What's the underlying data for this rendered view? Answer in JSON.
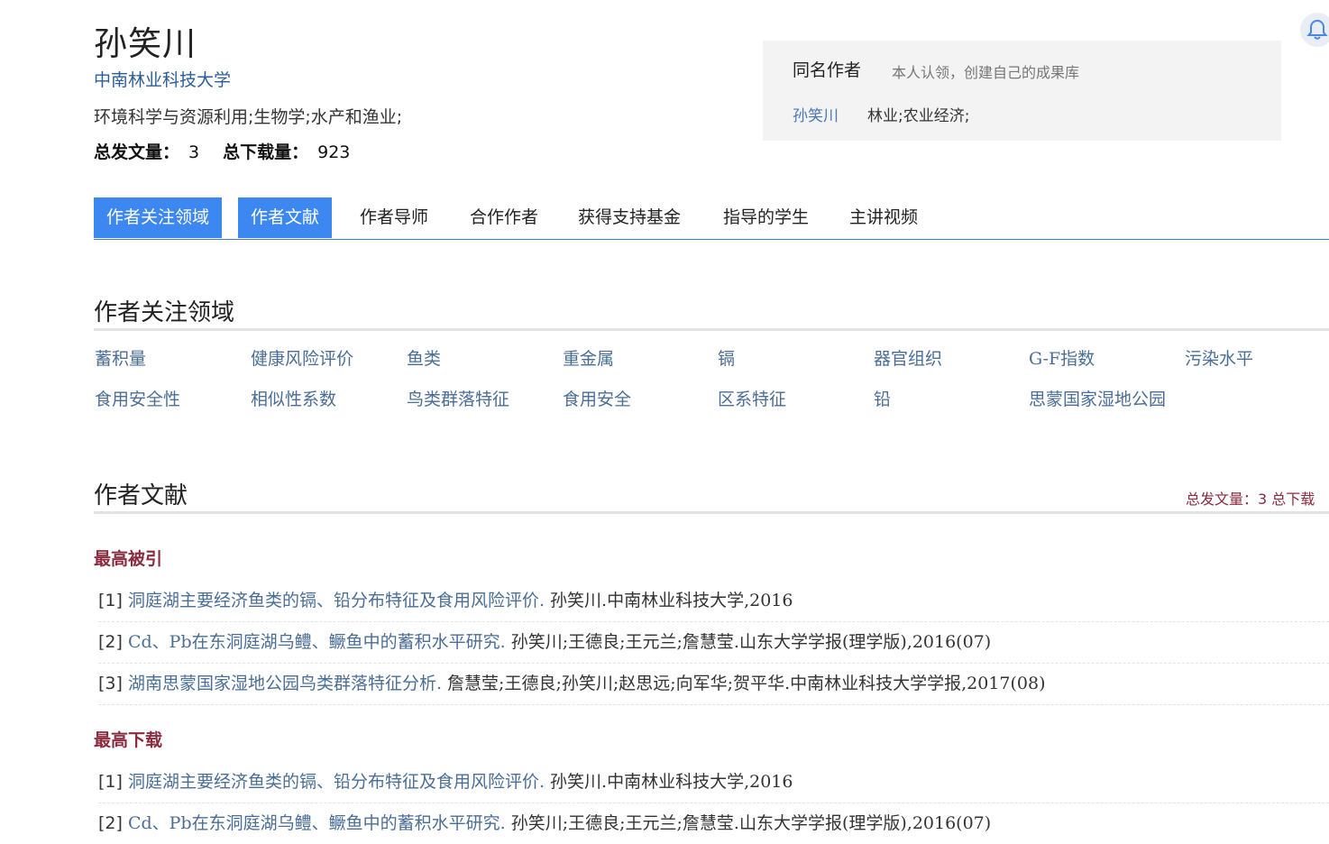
{
  "author": {
    "name": "孙笑川",
    "affiliation": "中南林业科技大学",
    "fields": "环境科学与资源利用;生物学;水产和渔业;",
    "total_pubs_label": "总发文量：",
    "total_pubs": "3",
    "total_downloads_label": "总下载量：",
    "total_downloads": "923"
  },
  "same_name": {
    "title": "同名作者",
    "hint": "本人认领，创建自己的成果库",
    "author_link": "孙笑川",
    "author_field": "林业;农业经济;"
  },
  "tabs": [
    "作者关注领域",
    "作者文献",
    "作者导师",
    "合作作者",
    "获得支持基金",
    "指导的学生",
    "主讲视频"
  ],
  "focus": {
    "title": "作者关注领域",
    "keywords_row1": [
      "蓄积量",
      "健康风险评价",
      "鱼类",
      "重金属",
      "镉",
      "器官组织",
      "G-F指数",
      "污染水平"
    ],
    "keywords_row2": [
      "食用安全性",
      "相似性系数",
      "鸟类群落特征",
      "食用安全",
      "区系特征",
      "铅",
      "思蒙国家湿地公园"
    ]
  },
  "literature": {
    "title": "作者文献",
    "summary": "总发文量：3 总下载",
    "most_cited": {
      "label": "最高被引",
      "items": [
        {
          "idx": "[1]",
          "title": "洞庭湖主要经济鱼类的镉、铅分布特征及食用风险评价.",
          "meta": " 孙笑川.中南林业科技大学,2016"
        },
        {
          "idx": "[2]",
          "title": "Cd、Pb在东洞庭湖乌鳢、鳜鱼中的蓄积水平研究.",
          "meta": " 孙笑川;王德良;王元兰;詹慧莹.山东大学学报(理学版),2016(07)"
        },
        {
          "idx": "[3]",
          "title": "湖南思蒙国家湿地公园鸟类群落特征分析.",
          "meta": " 詹慧莹;王德良;孙笑川;赵思远;向军华;贺平华.中南林业科技大学学报,2017(08)"
        }
      ]
    },
    "most_downloaded": {
      "label": "最高下载",
      "items": [
        {
          "idx": "[1]",
          "title": "洞庭湖主要经济鱼类的镉、铅分布特征及食用风险评价.",
          "meta": " 孙笑川.中南林业科技大学,2016"
        },
        {
          "idx": "[2]",
          "title": "Cd、Pb在东洞庭湖乌鳢、鳜鱼中的蓄积水平研究.",
          "meta": " 孙笑川;王德良;王元兰;詹慧莹.山东大学学报(理学版),2016(07)"
        }
      ]
    }
  },
  "icons": {
    "notification": "bell-icon"
  },
  "colors": {
    "tab_active": "#3d87f0",
    "link": "#4a6e96",
    "accent": "#8a2b3f"
  }
}
